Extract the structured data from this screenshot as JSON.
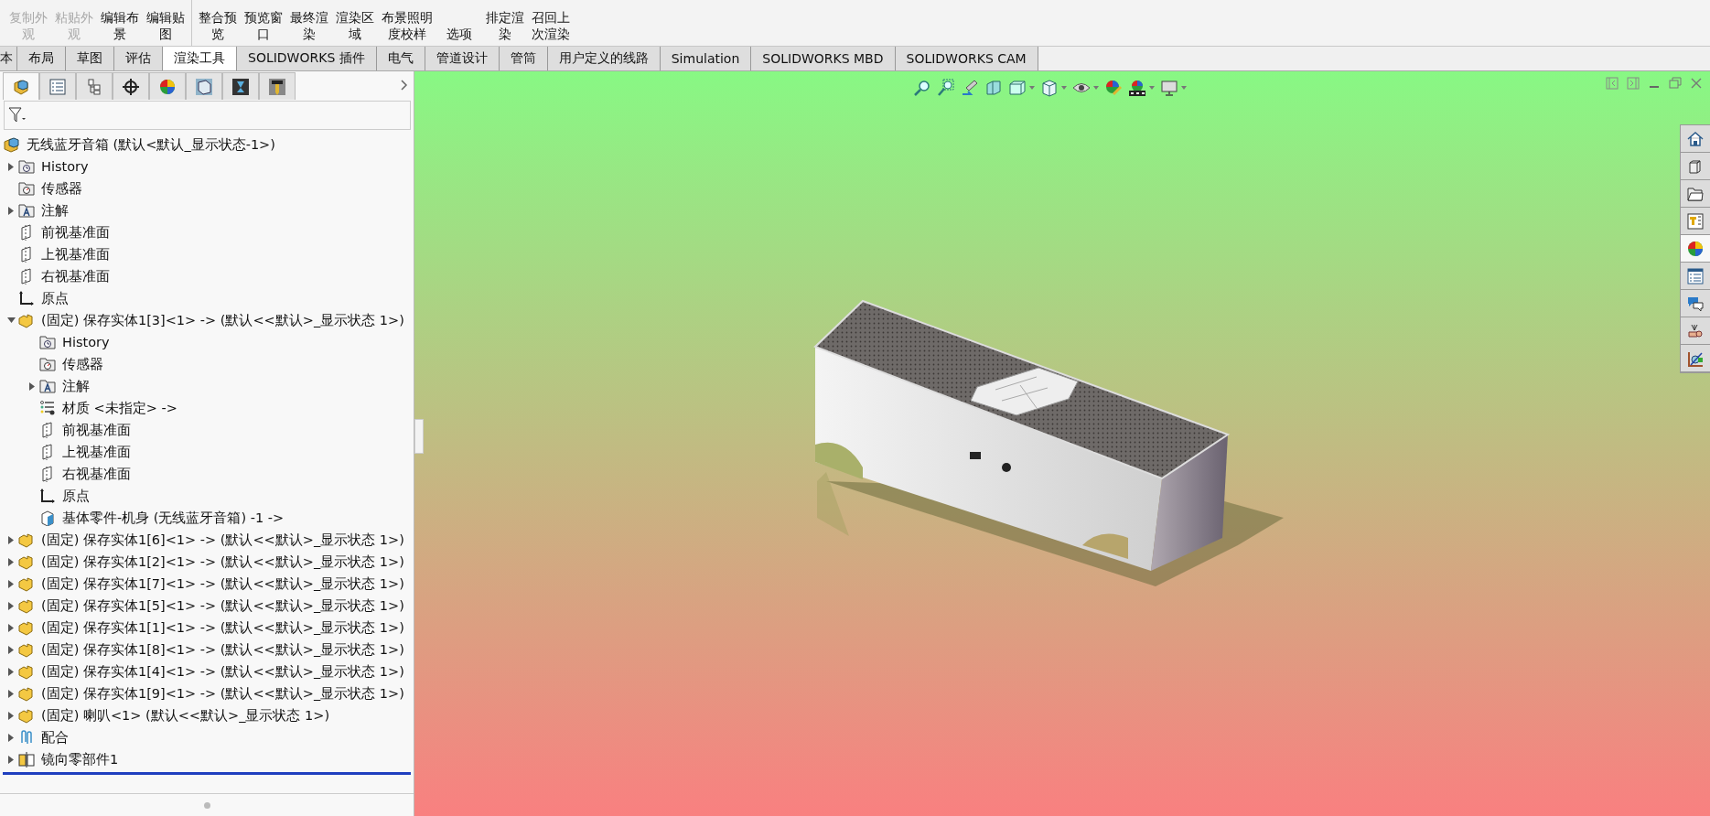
{
  "ribbon": {
    "buttons": [
      {
        "label": "复制外观",
        "disabled": true
      },
      {
        "label": "粘贴外观",
        "disabled": true
      },
      {
        "label": "编辑布景",
        "disabled": false
      },
      {
        "label": "编辑贴图",
        "disabled": false
      },
      {
        "label": "整合预览",
        "disabled": false
      },
      {
        "label": "预览窗口",
        "disabled": false
      },
      {
        "label": "最终渲染",
        "disabled": false
      },
      {
        "label": "渲染区域",
        "disabled": false
      },
      {
        "label": "布景照明度校样",
        "disabled": false
      },
      {
        "label": "选项",
        "disabled": false
      },
      {
        "label": "排定渲染",
        "disabled": false
      },
      {
        "label": "召回上次渲染",
        "disabled": false
      }
    ]
  },
  "tabs": [
    {
      "label": "本",
      "selected": false
    },
    {
      "label": "布局",
      "selected": false
    },
    {
      "label": "草图",
      "selected": false
    },
    {
      "label": "评估",
      "selected": false
    },
    {
      "label": "渲染工具",
      "selected": true
    },
    {
      "label": "SOLIDWORKS 插件",
      "selected": false
    },
    {
      "label": "电气",
      "selected": false
    },
    {
      "label": "管道设计",
      "selected": false
    },
    {
      "label": "管筒",
      "selected": false
    },
    {
      "label": "用户定义的线路",
      "selected": false
    },
    {
      "label": "Simulation",
      "selected": false
    },
    {
      "label": "SOLIDWORKS MBD",
      "selected": false
    },
    {
      "label": "SOLIDWORKS CAM",
      "selected": false
    }
  ],
  "panel_tabs": [
    {
      "kind": "cube",
      "selected": true
    },
    {
      "kind": "list",
      "selected": false
    },
    {
      "kind": "config",
      "selected": false
    },
    {
      "kind": "crosshair",
      "selected": false
    },
    {
      "kind": "ball",
      "selected": false
    },
    {
      "kind": "box",
      "selected": false
    },
    {
      "kind": "hourglass",
      "selected": false
    },
    {
      "kind": "drill",
      "selected": false
    }
  ],
  "tree": {
    "kind": "assembly",
    "label": "无线蓝牙音箱  (默认<默认_显示状态-1>)",
    "children": [
      {
        "kind": "history",
        "label": "History",
        "expanded": false
      },
      {
        "kind": "sensor",
        "label": "传感器"
      },
      {
        "kind": "annotation",
        "label": "注解",
        "expanded": false
      },
      {
        "kind": "plane",
        "label": "前视基准面"
      },
      {
        "kind": "plane",
        "label": "上视基准面"
      },
      {
        "kind": "plane",
        "label": "右视基准面"
      },
      {
        "kind": "origin",
        "label": "原点"
      },
      {
        "kind": "part",
        "label": "(固定) 保存实体1[3]<1> -> (默认<<默认>_显示状态 1>)",
        "expanded": true,
        "children": [
          {
            "kind": "history",
            "label": "History"
          },
          {
            "kind": "sensor",
            "label": "传感器"
          },
          {
            "kind": "annotation",
            "label": "注解",
            "expanded": false
          },
          {
            "kind": "material",
            "label": "材质 <未指定> ->"
          },
          {
            "kind": "plane",
            "label": "前视基准面"
          },
          {
            "kind": "plane",
            "label": "上视基准面"
          },
          {
            "kind": "plane",
            "label": "右视基准面"
          },
          {
            "kind": "origin",
            "label": "原点"
          },
          {
            "kind": "body",
            "label": "基体零件-机身  (无线蓝牙音箱)  -1 ->"
          }
        ]
      },
      {
        "kind": "part",
        "label": "(固定) 保存实体1[6]<1> -> (默认<<默认>_显示状态 1>)",
        "expanded": false
      },
      {
        "kind": "part",
        "label": "(固定) 保存实体1[2]<1> -> (默认<<默认>_显示状态 1>)",
        "expanded": false
      },
      {
        "kind": "part",
        "label": "(固定) 保存实体1[7]<1> -> (默认<<默认>_显示状态 1>)",
        "expanded": false
      },
      {
        "kind": "part",
        "label": "(固定) 保存实体1[5]<1> -> (默认<<默认>_显示状态 1>)",
        "expanded": false
      },
      {
        "kind": "part",
        "label": "(固定) 保存实体1[1]<1> -> (默认<<默认>_显示状态 1>)",
        "expanded": false
      },
      {
        "kind": "part",
        "label": "(固定) 保存实体1[8]<1> -> (默认<<默认>_显示状态 1>)",
        "expanded": false
      },
      {
        "kind": "part",
        "label": "(固定) 保存实体1[4]<1> -> (默认<<默认>_显示状态 1>)",
        "expanded": false
      },
      {
        "kind": "part",
        "label": "(固定) 保存实体1[9]<1> -> (默认<<默认>_显示状态 1>)",
        "expanded": false
      },
      {
        "kind": "part",
        "label": "(固定) 喇叭<1> (默认<<默认>_显示状态 1>)",
        "expanded": false
      },
      {
        "kind": "mate",
        "label": "配合",
        "expanded": false
      },
      {
        "kind": "mirror",
        "label": "镜向零部件1",
        "expanded": false
      }
    ]
  },
  "task_pane": [
    {
      "kind": "home",
      "selected": false
    },
    {
      "kind": "library",
      "selected": false
    },
    {
      "kind": "folder",
      "selected": false
    },
    {
      "kind": "palette",
      "selected": false
    },
    {
      "kind": "appearance",
      "selected": true
    },
    {
      "kind": "properties",
      "selected": false
    },
    {
      "kind": "forum",
      "selected": false
    },
    {
      "kind": "electrical",
      "selected": false
    },
    {
      "kind": "routing",
      "selected": false
    }
  ]
}
